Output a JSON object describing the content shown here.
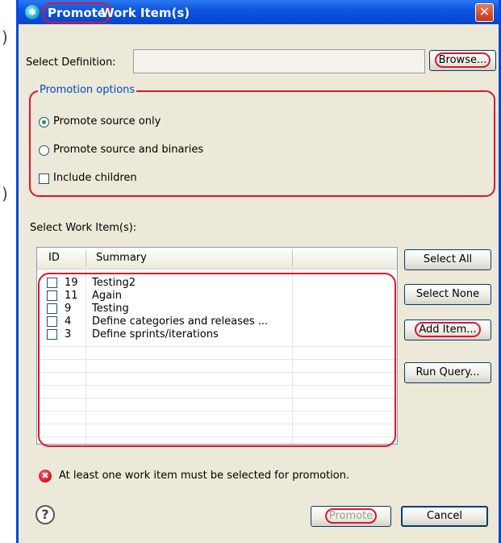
{
  "side_marks": [
    ")",
    ")"
  ],
  "window": {
    "title_highlight": "Promote",
    "title_rest": "Work Item(s)",
    "close_glyph": "✕",
    "app_icon_glyph": "✱"
  },
  "definition": {
    "label": "Select Definition:",
    "value": "",
    "browse_label": "Browse..."
  },
  "promotion_options": {
    "legend": "Promotion options",
    "options": [
      {
        "label": "Promote source only",
        "selected": true
      },
      {
        "label": "Promote source and binaries",
        "selected": false
      }
    ],
    "include_children_label": "Include children",
    "include_children_checked": false
  },
  "work_items": {
    "label": "Select Work Item(s):",
    "columns": [
      "ID",
      "Summary"
    ],
    "rows": [
      {
        "id": "19",
        "summary": "Testing2"
      },
      {
        "id": "11",
        "summary": "Again"
      },
      {
        "id": "9",
        "summary": "Testing"
      },
      {
        "id": "4",
        "summary": "Define categories and releases ..."
      },
      {
        "id": "3",
        "summary": "Define sprints/iterations"
      }
    ]
  },
  "side_buttons": {
    "select_all": "Select All",
    "select_none": "Select None",
    "add_item": "Add Item...",
    "run_query": "Run Query..."
  },
  "error": {
    "icon_glyph": "✖",
    "message": "At least one work item must be selected for promotion."
  },
  "footer": {
    "help_glyph": "?",
    "promote_label": "Promote",
    "cancel_label": "Cancel"
  },
  "colors": {
    "titlebar": "#0a53e0",
    "dialog_bg": "#ece9d8",
    "annotation_red": "#e0152a",
    "legend_blue": "#0046d5"
  }
}
